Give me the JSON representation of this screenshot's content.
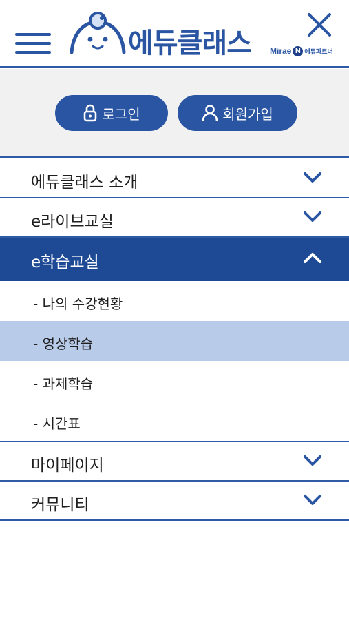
{
  "header": {
    "logo_text": "에듀클래스",
    "partner_brand": "Mirae",
    "partner_badge": "N",
    "partner_tag": "에듀파트너"
  },
  "auth": {
    "login_label": "로그인",
    "signup_label": "회원가입"
  },
  "menu": {
    "items": [
      {
        "label": "에듀클래스 소개",
        "icon": "chevron-down-icon"
      },
      {
        "label": "e라이브교실",
        "icon": "chevron-down-icon"
      },
      {
        "label": "e학습교실",
        "icon": "chevron-up-icon",
        "expanded": true
      },
      {
        "label": "마이페이지",
        "icon": "chevron-down-icon"
      },
      {
        "label": "커뮤니티",
        "icon": "chevron-down-icon"
      }
    ],
    "submenu": [
      {
        "label": "- 나의 수강현황"
      },
      {
        "label": "- 영상학습",
        "selected": true
      },
      {
        "label": "- 과제학습"
      },
      {
        "label": "- 시간표"
      }
    ]
  },
  "colors": {
    "primary": "#2a55a3",
    "active_bg": "#1e4a95",
    "selected_bg": "#b8cbe9",
    "auth_bg": "#f1f1f1"
  }
}
